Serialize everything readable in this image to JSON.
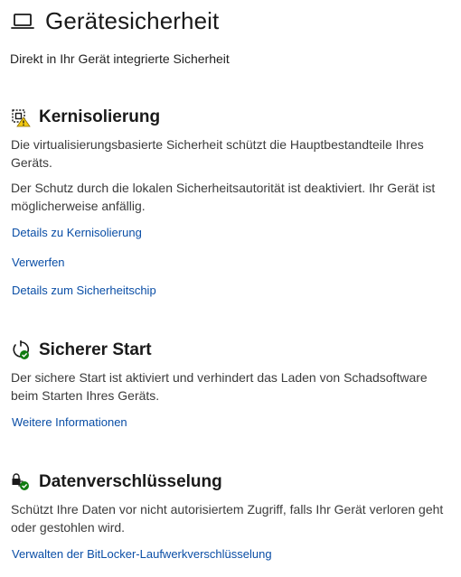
{
  "page": {
    "title": "Gerätesicherheit",
    "subtitle": "Direkt in Ihr Gerät integrierte Sicherheit"
  },
  "core_isolation": {
    "title": "Kernisolierung",
    "paragraph1": "Die virtualisierungsbasierte Sicherheit schützt die Hauptbestandteile Ihres Geräts.",
    "paragraph2": "Der Schutz durch die lokalen Sicherheitsautorität ist deaktiviert. Ihr Gerät ist möglicherweise anfällig.",
    "link_details": "Details zu Kernisolierung",
    "link_dismiss": "Verwerfen",
    "link_chip": "Details zum Sicherheitschip"
  },
  "secure_boot": {
    "title": "Sicherer Start",
    "paragraph": "Der sichere Start ist aktiviert und verhindert das Laden von Schadsoftware beim Starten Ihres Geräts.",
    "link": "Weitere Informationen"
  },
  "encryption": {
    "title": "Datenverschlüsselung",
    "paragraph": "Schützt Ihre Daten vor nicht autorisiertem Zugriff, falls Ihr Gerät verloren geht oder gestohlen wird.",
    "link": "Verwalten der BitLocker-Laufwerkverschlüsselung"
  },
  "icons": {
    "header": "laptop-icon",
    "core_isolation": "core-isolation-warning-icon",
    "secure_boot": "secure-boot-check-icon",
    "encryption": "lock-check-icon"
  },
  "colors": {
    "link": "#0a4ea6",
    "warning": "#f2c811",
    "success": "#107c10"
  }
}
